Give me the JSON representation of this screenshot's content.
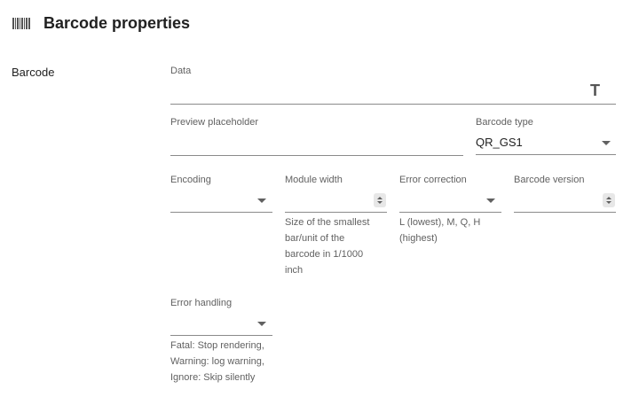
{
  "header": {
    "title": "Barcode properties",
    "icon": "barcode-icon"
  },
  "section": {
    "label": "Barcode"
  },
  "fields": {
    "data": {
      "label": "Data",
      "value": "",
      "icon": "text-type-icon"
    },
    "preview_placeholder": {
      "label": "Preview placeholder",
      "value": ""
    },
    "barcode_type": {
      "label": "Barcode type",
      "value": "QR_GS1"
    },
    "encoding": {
      "label": "Encoding",
      "value": ""
    },
    "module_width": {
      "label": "Module width",
      "value": "",
      "hint": "Size of the smallest bar/unit of the barcode in 1/1000 inch",
      "hint_lines": [
        "Size of the smallest",
        "bar/unit of the",
        "barcode in 1/1000",
        "inch"
      ]
    },
    "error_correction": {
      "label": "Error correction",
      "value": "",
      "hint_lines": [
        "L (lowest), M, Q, H",
        "(highest)"
      ]
    },
    "barcode_version": {
      "label": "Barcode version",
      "value": ""
    },
    "error_handling": {
      "label": "Error handling",
      "value": "",
      "hint_lines": [
        "Fatal: Stop rendering,",
        "Warning: log warning,",
        "Ignore: Skip silently"
      ]
    }
  }
}
